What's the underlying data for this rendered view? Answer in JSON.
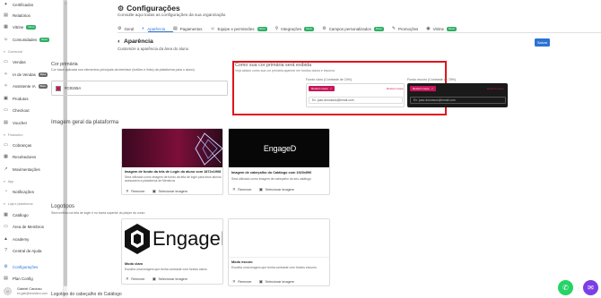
{
  "sidebar": {
    "items_top": [
      {
        "label": "Certificados",
        "icon": "certificate-icon"
      },
      {
        "label": "Relatórios",
        "icon": "report-icon"
      },
      {
        "label": "Vitrine",
        "icon": "storefront-icon",
        "badge": "Novo"
      },
      {
        "label": "Comunidades",
        "icon": "community-icon",
        "badge": "Novo"
      }
    ],
    "section_comercial": "Comercial",
    "items_comercial": [
      {
        "label": "Vendas",
        "icon": "sales-icon"
      },
      {
        "label": "IA de Vendas",
        "icon": "ai-sales-icon",
        "badge": "Beta"
      },
      {
        "label": "Assistente IA",
        "icon": "ai-assistant-icon",
        "badge": "Beta"
      },
      {
        "label": "Produtos",
        "icon": "products-icon"
      },
      {
        "label": "Checkout",
        "icon": "checkout-icon"
      },
      {
        "label": "Voucher",
        "icon": "voucher-icon"
      }
    ],
    "section_financeiro": "Financeiro",
    "items_financeiro": [
      {
        "label": "Cobranças",
        "icon": "billing-icon"
      },
      {
        "label": "Recebedores",
        "icon": "receivers-icon"
      },
      {
        "label": "Movimentações",
        "icon": "transactions-icon"
      }
    ],
    "section_app": "App",
    "items_app": [
      {
        "label": "Notificações",
        "icon": "notifications-icon"
      }
    ],
    "section_loja": "Loja e plataforma",
    "items_loja": [
      {
        "label": "Catálogo",
        "icon": "catalog-icon"
      },
      {
        "label": "Área de Membros",
        "icon": "members-area-icon"
      },
      {
        "label": "Academy",
        "icon": "academy-icon"
      },
      {
        "label": "Central de Ajuda",
        "icon": "help-center-icon"
      }
    ],
    "items_bottom": [
      {
        "label": "Configurações",
        "icon": "gear-icon",
        "active": true
      },
      {
        "label": "Plan Config",
        "icon": "plan-icon"
      }
    ],
    "user": {
      "name": "Gabriel Cardoso",
      "email": "ex.gab@ensidero.com"
    }
  },
  "header": {
    "title": "Configurações",
    "subtitle": "Consulte aqui todas as configurações da sua organização"
  },
  "tabs": [
    {
      "label": "Geral",
      "icon": "gear-icon"
    },
    {
      "label": "Aparência",
      "icon": "palette-icon",
      "active": true
    },
    {
      "label": "Pagamentos",
      "icon": "payment-icon"
    },
    {
      "label": "Equipe e permissões",
      "icon": "team-icon",
      "badge": "Novo"
    },
    {
      "label": "Integrações",
      "icon": "integration-icon",
      "badge": "Novo"
    },
    {
      "label": "Campos personalizados",
      "icon": "custom-fields-icon",
      "badge": "Novo"
    },
    {
      "label": "Promoções",
      "icon": "promotion-icon"
    },
    {
      "label": "Vitrine",
      "icon": "storefront-icon",
      "badge": "Novo"
    }
  ],
  "section": {
    "title": "Aparência",
    "subtitle": "Customize a aparência da área do aluno",
    "save_label": "Salvar"
  },
  "primary_color": {
    "title": "Cor primária",
    "description": "Cor base aplicada nos elementos principais da interface (botões e links) da plataforma para o aluno)",
    "value": "#C8155A",
    "swatch": "#c8155a"
  },
  "preview": {
    "title": "Como sua cor primária será exibida",
    "description": "Veja abaixo como sua cor primária aparece em fundos claros e escuros",
    "light_label": "Fundo claro (Contraste de 24%)",
    "dark_label": "Fundo escuro (Contraste de 78%)",
    "button_label": "Restart coupe",
    "link_label": "Restart coupe",
    "email_text": "Ex: joao.donossos@email.com"
  },
  "images": {
    "title": "Imagem geral da plataforma",
    "cards": [
      {
        "title": "Imagem de fundo da tela de Login do aluno com 1872x1908",
        "description": "Será utilizado como imagem de fundo da tela de login para seus alunos acessarem a plataforma de Membros",
        "remove": "Remover",
        "select": "Selecionar imagem"
      },
      {
        "title": "Imagem de cabeçalho do Catálogo com 1920x590",
        "description": "Será utilizado como imagem de cabeçalho do seu catálogo",
        "remove": "Remover",
        "select": "Selecionar imagem",
        "logo_text": "EngageD"
      }
    ]
  },
  "logos": {
    "title": "Logotipos",
    "subtitle": "Será exibido na tela de login e no barra superior do player do curso",
    "cards": [
      {
        "title": "Modo claro",
        "description": "Escolha uma imagem que tenha contraste com fundos claros",
        "remove": "Remover",
        "select": "Selecionar imagem",
        "logo_text": "EngageD"
      },
      {
        "title": "Modo escuro",
        "description": "Escolha uma imagem que tenha contraste com fundos escuros",
        "remove": "Remover",
        "select": "Selecionar imagem"
      }
    ]
  },
  "bottom_section_title": "Logotipo do cabeçalho do Catálogo"
}
